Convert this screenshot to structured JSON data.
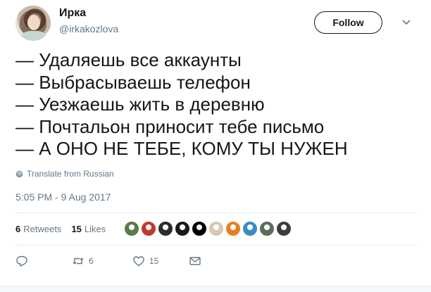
{
  "author": {
    "name": "Ирка",
    "handle": "@irkakozlova",
    "avatar_icon": "user-avatar"
  },
  "follow_button": {
    "label": "Follow"
  },
  "menu_caret_icon": "chevron-down-icon",
  "tweet": {
    "lines": [
      "— Удаляешь все аккаунты",
      "— Выбрасываешь телефон",
      "— Уезжаешь жить в деревню",
      "— Почтальон приносит тебе письмо",
      "— А ОНО НЕ ТЕБЕ, КОМУ ТЫ НУЖЕН"
    ],
    "translate_label": "Translate from Russian",
    "timestamp": "5:05 PM - 9 Aug 2017"
  },
  "stats": {
    "retweets_count": "6",
    "retweets_label": "Retweets",
    "likes_count": "15",
    "likes_label": "Likes",
    "liker_colors": [
      "#5a7a4a",
      "#c0392b",
      "#2c2c2c",
      "#1a1a1a",
      "#000000",
      "#d8c8b0",
      "#e67e22",
      "#3b8ac4",
      "#5d6d5a",
      "#3d3d3d"
    ]
  },
  "actions": {
    "reply_icon": "reply-icon",
    "retweet_icon": "retweet-icon",
    "retweet_count": "6",
    "like_icon": "heart-icon",
    "like_count": "15",
    "message_icon": "envelope-icon"
  },
  "colors": {
    "text_primary": "#14171a",
    "text_secondary": "#657786",
    "divider": "#e6ecf0"
  }
}
